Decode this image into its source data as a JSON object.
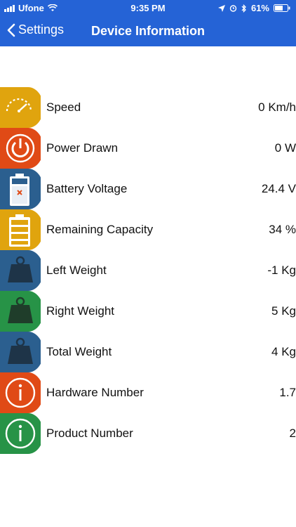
{
  "status_bar": {
    "carrier": "Ufone",
    "time": "9:35 PM",
    "battery": "61%"
  },
  "nav": {
    "back_label": "Settings",
    "title": "Device Information"
  },
  "colors": {
    "header_blue": "#2563d6",
    "yellow": "#e0a40e",
    "red": "#e04a16",
    "navy": "#2b5f8f",
    "green": "#279347"
  },
  "items": [
    {
      "label": "Speed",
      "value": "0 Km/h",
      "icon": "speedometer-icon",
      "color": "yellow"
    },
    {
      "label": "Power Drawn",
      "value": "0 W",
      "icon": "power-icon",
      "color": "red"
    },
    {
      "label": "Battery Voltage",
      "value": "24.4 V",
      "icon": "battery-voltage-icon",
      "color": "navy"
    },
    {
      "label": "Remaining Capacity",
      "value": "34 %",
      "icon": "battery-capacity-icon",
      "color": "yellow"
    },
    {
      "label": "Left Weight",
      "value": "-1 Kg",
      "icon": "weight-icon",
      "color": "navy"
    },
    {
      "label": "Right Weight",
      "value": "5 Kg",
      "icon": "weight-icon",
      "color": "green"
    },
    {
      "label": "Total Weight",
      "value": "4 Kg",
      "icon": "weight-icon",
      "color": "navy"
    },
    {
      "label": "Hardware Number",
      "value": "1.7",
      "icon": "info-icon",
      "color": "red"
    },
    {
      "label": "Product Number",
      "value": "2",
      "icon": "info-icon",
      "color": "green"
    }
  ]
}
